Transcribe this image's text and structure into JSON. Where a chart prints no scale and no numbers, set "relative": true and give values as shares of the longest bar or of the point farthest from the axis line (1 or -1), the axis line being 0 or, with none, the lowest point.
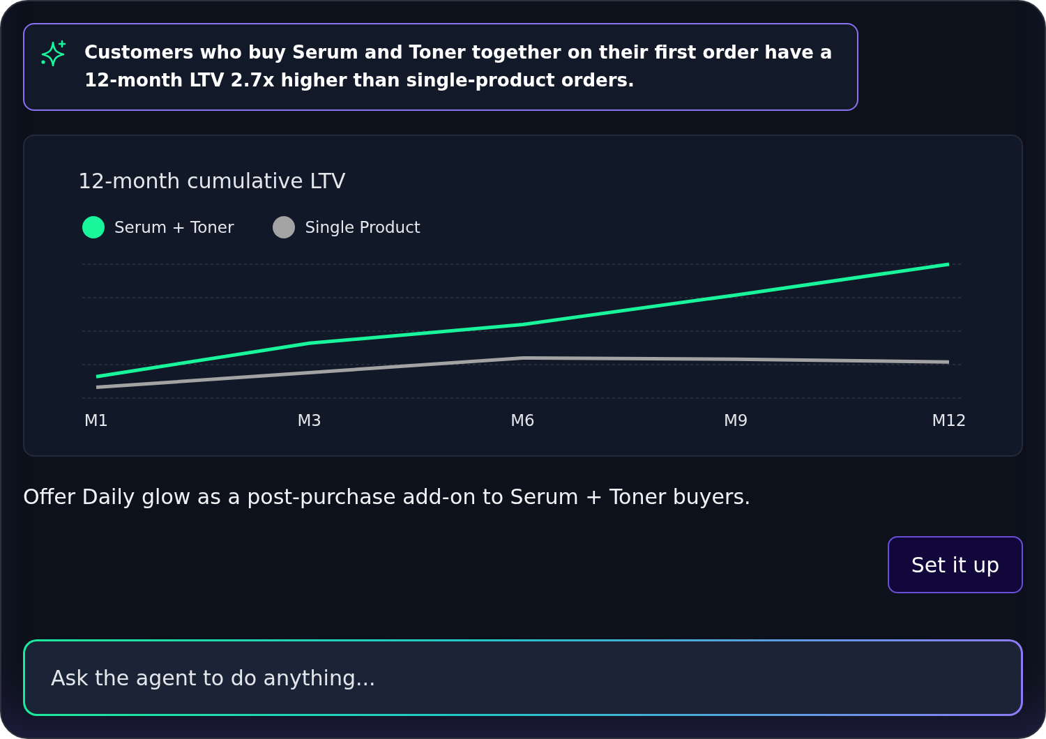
{
  "insight": {
    "text": "Customers who buy Serum and Toner together on their first order have a 12-month LTV 2.7x higher than single-product orders."
  },
  "chart": {
    "chart_data": {
      "type": "line",
      "title": "12-month cumulative LTV",
      "relative": true,
      "legend": "top-left",
      "categories": [
        "M1",
        "M3",
        "M6",
        "M9",
        "M12"
      ],
      "series": [
        {
          "name": "Serum + Toner",
          "color": "#19f59b",
          "values": [
            0.16,
            0.41,
            0.55,
            0.77,
            1.0
          ]
        },
        {
          "name": "Single Product",
          "color": "#a3a3a3",
          "values": [
            0.08,
            0.19,
            0.3,
            0.29,
            0.27
          ]
        }
      ]
    }
  },
  "recommendation": "Offer Daily glow as a post-purchase add-on to Serum + Toner buyers.",
  "action_button": {
    "label": "Set it up"
  },
  "prompt_input": {
    "placeholder": "Ask the agent to do anything..."
  }
}
